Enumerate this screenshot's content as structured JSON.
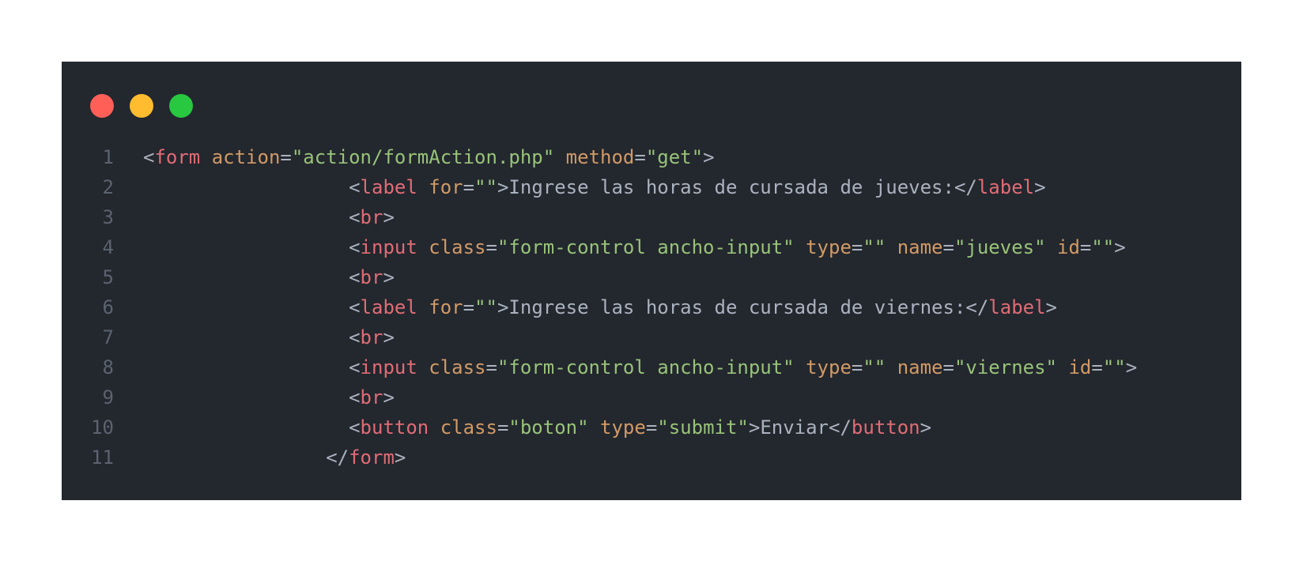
{
  "window_controls": {
    "close_color": "#ff5f57",
    "minimize_color": "#febc2e",
    "maximize_color": "#28c840"
  },
  "code": {
    "language": "html",
    "lines": [
      {
        "number": "1",
        "indent": "",
        "tokens": [
          {
            "t": "p",
            "v": "<"
          },
          {
            "t": "t",
            "v": "form"
          },
          {
            "t": "p",
            "v": " "
          },
          {
            "t": "a",
            "v": "action"
          },
          {
            "t": "p",
            "v": "="
          },
          {
            "t": "s",
            "v": "\"action/formAction.php\""
          },
          {
            "t": "p",
            "v": " "
          },
          {
            "t": "a",
            "v": "method"
          },
          {
            "t": "p",
            "v": "="
          },
          {
            "t": "s",
            "v": "\"get\""
          },
          {
            "t": "p",
            "v": ">"
          }
        ]
      },
      {
        "number": "2",
        "indent": "                  ",
        "tokens": [
          {
            "t": "p",
            "v": "<"
          },
          {
            "t": "t",
            "v": "label"
          },
          {
            "t": "p",
            "v": " "
          },
          {
            "t": "a",
            "v": "for"
          },
          {
            "t": "p",
            "v": "="
          },
          {
            "t": "s",
            "v": "\"\""
          },
          {
            "t": "p",
            "v": ">"
          },
          {
            "t": "x",
            "v": "Ingrese las horas de cursada de jueves:"
          },
          {
            "t": "p",
            "v": "</"
          },
          {
            "t": "t",
            "v": "label"
          },
          {
            "t": "p",
            "v": ">"
          }
        ]
      },
      {
        "number": "3",
        "indent": "                  ",
        "tokens": [
          {
            "t": "p",
            "v": "<"
          },
          {
            "t": "t",
            "v": "br"
          },
          {
            "t": "p",
            "v": ">"
          }
        ]
      },
      {
        "number": "4",
        "indent": "                  ",
        "tokens": [
          {
            "t": "p",
            "v": "<"
          },
          {
            "t": "t",
            "v": "input"
          },
          {
            "t": "p",
            "v": " "
          },
          {
            "t": "a",
            "v": "class"
          },
          {
            "t": "p",
            "v": "="
          },
          {
            "t": "s",
            "v": "\"form-control ancho-input\""
          },
          {
            "t": "p",
            "v": " "
          },
          {
            "t": "a",
            "v": "type"
          },
          {
            "t": "p",
            "v": "="
          },
          {
            "t": "s",
            "v": "\"\""
          },
          {
            "t": "p",
            "v": " "
          },
          {
            "t": "a",
            "v": "name"
          },
          {
            "t": "p",
            "v": "="
          },
          {
            "t": "s",
            "v": "\"jueves\""
          },
          {
            "t": "p",
            "v": " "
          },
          {
            "t": "a",
            "v": "id"
          },
          {
            "t": "p",
            "v": "="
          },
          {
            "t": "s",
            "v": "\"\""
          },
          {
            "t": "p",
            "v": ">"
          }
        ]
      },
      {
        "number": "5",
        "indent": "                  ",
        "tokens": [
          {
            "t": "p",
            "v": "<"
          },
          {
            "t": "t",
            "v": "br"
          },
          {
            "t": "p",
            "v": ">"
          }
        ]
      },
      {
        "number": "6",
        "indent": "                  ",
        "tokens": [
          {
            "t": "p",
            "v": "<"
          },
          {
            "t": "t",
            "v": "label"
          },
          {
            "t": "p",
            "v": " "
          },
          {
            "t": "a",
            "v": "for"
          },
          {
            "t": "p",
            "v": "="
          },
          {
            "t": "s",
            "v": "\"\""
          },
          {
            "t": "p",
            "v": ">"
          },
          {
            "t": "x",
            "v": "Ingrese las horas de cursada de viernes:"
          },
          {
            "t": "p",
            "v": "</"
          },
          {
            "t": "t",
            "v": "label"
          },
          {
            "t": "p",
            "v": ">"
          }
        ]
      },
      {
        "number": "7",
        "indent": "                  ",
        "tokens": [
          {
            "t": "p",
            "v": "<"
          },
          {
            "t": "t",
            "v": "br"
          },
          {
            "t": "p",
            "v": ">"
          }
        ]
      },
      {
        "number": "8",
        "indent": "                  ",
        "tokens": [
          {
            "t": "p",
            "v": "<"
          },
          {
            "t": "t",
            "v": "input"
          },
          {
            "t": "p",
            "v": " "
          },
          {
            "t": "a",
            "v": "class"
          },
          {
            "t": "p",
            "v": "="
          },
          {
            "t": "s",
            "v": "\"form-control ancho-input\""
          },
          {
            "t": "p",
            "v": " "
          },
          {
            "t": "a",
            "v": "type"
          },
          {
            "t": "p",
            "v": "="
          },
          {
            "t": "s",
            "v": "\"\""
          },
          {
            "t": "p",
            "v": " "
          },
          {
            "t": "a",
            "v": "name"
          },
          {
            "t": "p",
            "v": "="
          },
          {
            "t": "s",
            "v": "\"viernes\""
          },
          {
            "t": "p",
            "v": " "
          },
          {
            "t": "a",
            "v": "id"
          },
          {
            "t": "p",
            "v": "="
          },
          {
            "t": "s",
            "v": "\"\""
          },
          {
            "t": "p",
            "v": ">"
          }
        ]
      },
      {
        "number": "9",
        "indent": "                  ",
        "tokens": [
          {
            "t": "p",
            "v": "<"
          },
          {
            "t": "t",
            "v": "br"
          },
          {
            "t": "p",
            "v": ">"
          }
        ]
      },
      {
        "number": "10",
        "indent": "                  ",
        "tokens": [
          {
            "t": "p",
            "v": "<"
          },
          {
            "t": "t",
            "v": "button"
          },
          {
            "t": "p",
            "v": " "
          },
          {
            "t": "a",
            "v": "class"
          },
          {
            "t": "p",
            "v": "="
          },
          {
            "t": "s",
            "v": "\"boton\""
          },
          {
            "t": "p",
            "v": " "
          },
          {
            "t": "a",
            "v": "type"
          },
          {
            "t": "p",
            "v": "="
          },
          {
            "t": "s",
            "v": "\"submit\""
          },
          {
            "t": "p",
            "v": ">"
          },
          {
            "t": "x",
            "v": "Enviar"
          },
          {
            "t": "p",
            "v": "</"
          },
          {
            "t": "t",
            "v": "button"
          },
          {
            "t": "p",
            "v": ">"
          }
        ]
      },
      {
        "number": "11",
        "indent": "                ",
        "tokens": [
          {
            "t": "p",
            "v": "</"
          },
          {
            "t": "t",
            "v": "form"
          },
          {
            "t": "p",
            "v": ">"
          }
        ]
      }
    ]
  }
}
